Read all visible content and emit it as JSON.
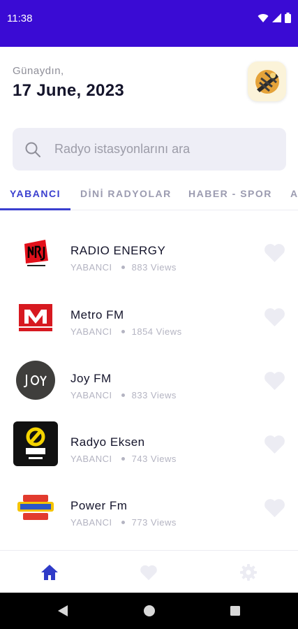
{
  "status_bar": {
    "time": "11:38",
    "background": "#3a0bd4",
    "icons": [
      "wifi-icon",
      "signal-icon",
      "battery-icon"
    ]
  },
  "header": {
    "greeting": "Günaydın,",
    "date": "17 June, 2023",
    "logo_icon": "radio-app-logo-icon"
  },
  "search": {
    "placeholder": "Radyo istasyonlarını ara",
    "value": ""
  },
  "tabs": [
    {
      "label": "YABANCI",
      "active": true
    },
    {
      "label": "DİNİ RADYOLAR",
      "active": false
    },
    {
      "label": "HABER - SPOR",
      "active": false
    },
    {
      "label": "A",
      "active": false
    }
  ],
  "accent_color": "#3a3fcf",
  "stations": [
    {
      "name": "RADIO ENERGY",
      "category": "YABANCI",
      "views": "883 Views",
      "logo": "nrj-logo-icon"
    },
    {
      "name": "Metro FM",
      "category": "YABANCI",
      "views": "1854 Views",
      "logo": "metro-fm-logo-icon"
    },
    {
      "name": "Joy FM",
      "category": "YABANCI",
      "views": "833 Views",
      "logo": "joy-fm-logo-icon"
    },
    {
      "name": "Radyo Eksen",
      "category": "YABANCI",
      "views": "743 Views",
      "logo": "radyo-eksen-logo-icon"
    },
    {
      "name": "Power Fm",
      "category": "YABANCI",
      "views": "773 Views",
      "logo": "power-fm-logo-icon"
    }
  ],
  "bottom_nav": [
    {
      "name": "home-icon",
      "active": true
    },
    {
      "name": "favorites-icon",
      "active": false
    },
    {
      "name": "settings-icon",
      "active": false
    }
  ],
  "system_nav": [
    "back-icon",
    "home-circle-icon",
    "recents-icon"
  ]
}
